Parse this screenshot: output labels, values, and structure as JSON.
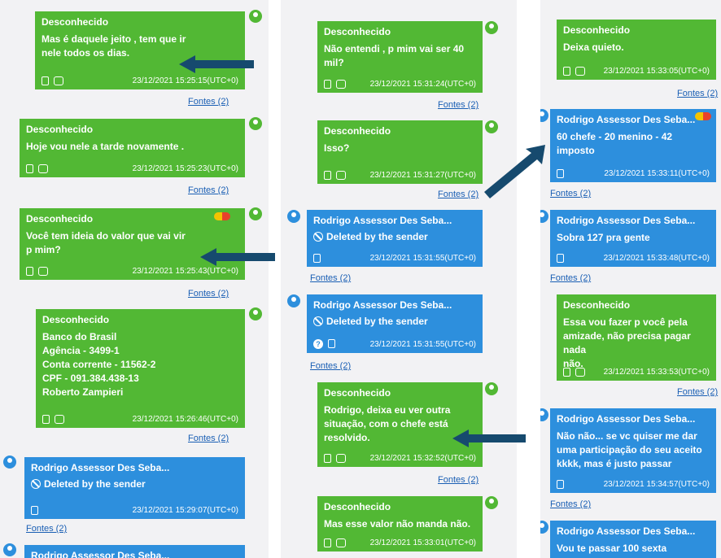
{
  "colors": {
    "green": "#52b834",
    "blue": "#2d8fdd",
    "arrow": "#164a6e",
    "link": "#1a5fb4"
  },
  "col1": [
    {
      "sender": "Desconhecido",
      "lines": [
        "Mas é daquele jeito , tem que ir",
        "nele todos os dias."
      ],
      "time": "23/12/2021 15:25:15(UTC+0)",
      "fontes": "Fontes (2)"
    },
    {
      "sender": "Desconhecido",
      "lines": [
        "Hoje vou nele a tarde novamente ."
      ],
      "time": "23/12/2021 15:25:23(UTC+0)",
      "fontes": "Fontes (2)"
    },
    {
      "sender": "Desconhecido",
      "lines": [
        "Você tem ideia do valor que vai vir",
        "p mim?"
      ],
      "time": "23/12/2021 15:25:43(UTC+0)",
      "fontes": "Fontes (2)"
    },
    {
      "sender": "Desconhecido",
      "lines": [
        "Banco do Brasil",
        "Agência - 3499-1",
        "Conta corrente - 11562-2",
        "CPF - 091.384.438-13",
        "Roberto Zampieri"
      ],
      "time": "23/12/2021 15:26:46(UTC+0)",
      "fontes": "Fontes (2)"
    },
    {
      "sender": "Rodrigo Assessor Des Seba...",
      "deleted": "Deleted by the sender",
      "time": "23/12/2021 15:29:07(UTC+0)",
      "fontes": "Fontes (2)"
    },
    {
      "sender": "Rodrigo Assessor Des Seba..."
    }
  ],
  "col2": [
    {
      "sender": "Desconhecido",
      "lines": [
        "Não entendi , p mim vai ser 40",
        "mil?"
      ],
      "time": "23/12/2021 15:31:24(UTC+0)",
      "fontes": "Fontes (2)"
    },
    {
      "sender": "Desconhecido",
      "lines": [
        "Isso?"
      ],
      "time": "23/12/2021 15:31:27(UTC+0)",
      "fontes": "Fontes (2)"
    },
    {
      "sender": "Rodrigo Assessor Des Seba...",
      "deleted": "Deleted by the sender",
      "time": "23/12/2021 15:31:55(UTC+0)",
      "fontes": "Fontes (2)"
    },
    {
      "sender": "Rodrigo Assessor Des Seba...",
      "deleted": "Deleted by the sender",
      "time": "23/12/2021 15:31:55(UTC+0)",
      "fontes": "Fontes (2)"
    },
    {
      "sender": "Desconhecido",
      "lines": [
        "Rodrigo, deixa eu ver outra",
        "situação, com o chefe está",
        "resolvido."
      ],
      "time": "23/12/2021 15:32:52(UTC+0)",
      "fontes": "Fontes (2)"
    },
    {
      "sender": "Desconhecido",
      "lines": [
        "Mas esse valor não manda não."
      ],
      "time": "23/12/2021 15:33:01(UTC+0)"
    }
  ],
  "col3": [
    {
      "sender": "Desconhecido",
      "lines": [
        "Deixa quieto."
      ],
      "time": "23/12/2021 15:33:05(UTC+0)",
      "fontes": "Fontes (2)"
    },
    {
      "sender": "Rodrigo Assessor Des Seba...",
      "lines": [
        "60 chefe - 20 menino - 42",
        "imposto"
      ],
      "time": "23/12/2021 15:33:11(UTC+0)",
      "fontes": "Fontes (2)"
    },
    {
      "sender": "Rodrigo Assessor Des Seba...",
      "lines": [
        "Sobra 127 pra gente"
      ],
      "time": "23/12/2021 15:33:48(UTC+0)",
      "fontes": "Fontes (2)"
    },
    {
      "sender": "Desconhecido",
      "lines": [
        "Essa vou fazer p você pela",
        "amizade, não precisa pagar nada",
        "não."
      ],
      "time": "23/12/2021 15:33:53(UTC+0)",
      "fontes": "Fontes (2)"
    },
    {
      "sender": "Rodrigo Assessor Des Seba...",
      "lines": [
        "Não não... se vc quiser me dar",
        "uma participação do seu aceito",
        "kkkk, mas é justo passar"
      ],
      "time": "23/12/2021 15:34:57(UTC+0)",
      "fontes": "Fontes (2)"
    },
    {
      "sender": "Rodrigo Assessor Des Seba...",
      "lines": [
        "Vou te passar 100 sexta"
      ]
    }
  ]
}
